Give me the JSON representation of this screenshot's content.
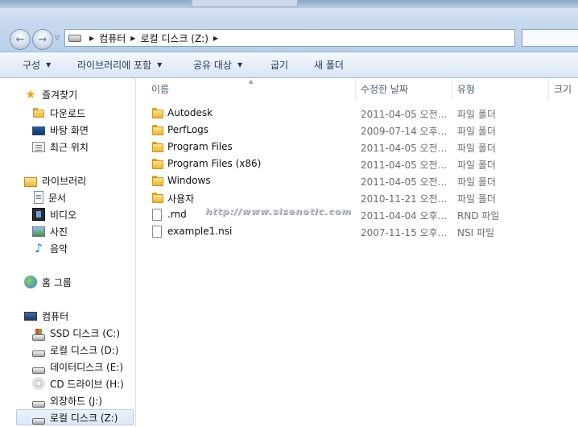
{
  "address": {
    "crumbs": [
      "컴퓨터",
      "로컬 디스크 (Z:)"
    ]
  },
  "toolbar": {
    "organize": "구성",
    "include_in_library": "라이브러리에 포함",
    "share_with": "공유 대상",
    "burn": "굽기",
    "new_folder": "새 폴더"
  },
  "nav": {
    "favorites": "즐겨찾기",
    "downloads": "다운로드",
    "desktop": "바탕 화면",
    "recent": "최근 위치",
    "libraries": "라이브러리",
    "documents": "문서",
    "videos": "비디오",
    "pictures": "사진",
    "music": "음악",
    "homegroup": "홈 그룹",
    "computer": "컴퓨터",
    "drives": [
      {
        "label": "SSD 디스크 (C:)"
      },
      {
        "label": "로컬 디스크 (D:)"
      },
      {
        "label": "데이터디스크 (E:)"
      },
      {
        "label": "CD 드라이브 (H:)"
      },
      {
        "label": "외장하드 (J:)"
      },
      {
        "label": "로컬 디스크 (Z:)"
      }
    ]
  },
  "columns": {
    "name": "이름",
    "modified": "수정한 날짜",
    "type": "유형",
    "size": "크기"
  },
  "files": [
    {
      "name": "Autodesk",
      "date": "2011-04-05 오전...",
      "type": "파일 폴더",
      "kind": "folder"
    },
    {
      "name": "PerfLogs",
      "date": "2009-07-14 오후...",
      "type": "파일 폴더",
      "kind": "folder"
    },
    {
      "name": "Program Files",
      "date": "2011-04-05 오전...",
      "type": "파일 폴더",
      "kind": "folder"
    },
    {
      "name": "Program Files (x86)",
      "date": "2011-04-05 오전...",
      "type": "파일 폴더",
      "kind": "folder"
    },
    {
      "name": "Windows",
      "date": "2011-04-05 오전...",
      "type": "파일 폴더",
      "kind": "folder"
    },
    {
      "name": "사용자",
      "date": "2010-11-21 오전...",
      "type": "파일 폴더",
      "kind": "folder"
    },
    {
      "name": ".rnd",
      "date": "2011-04-04 오후...",
      "type": "RND 파일",
      "kind": "file"
    },
    {
      "name": "example1.nsi",
      "date": "2007-11-15 오후...",
      "type": "NSI 파일",
      "kind": "file"
    }
  ],
  "watermark": "http://www.sisenotic.com"
}
